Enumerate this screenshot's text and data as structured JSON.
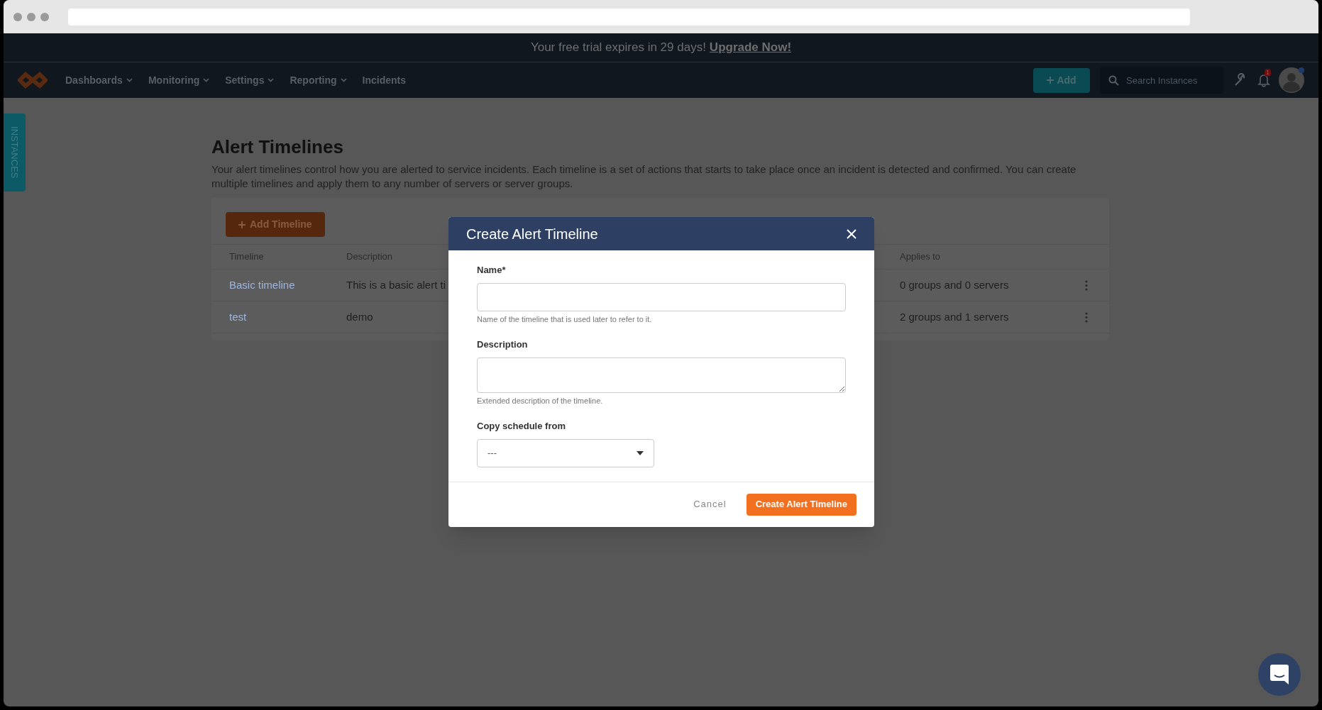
{
  "banner": {
    "text": "Your free trial expires in 29 days!",
    "link": "Upgrade Now!"
  },
  "nav": {
    "items": [
      {
        "label": "Dashboards",
        "dropdown": true
      },
      {
        "label": "Monitoring",
        "dropdown": true
      },
      {
        "label": "Settings",
        "dropdown": true
      },
      {
        "label": "Reporting",
        "dropdown": true
      },
      {
        "label": "Incidents",
        "dropdown": false
      }
    ],
    "add_button": "Add",
    "search": {
      "placeholder": "Search Instances"
    },
    "notification_count": "1"
  },
  "side_tab": "INSTANCES",
  "page": {
    "title": "Alert Timelines",
    "description": "Your alert timelines control how you are alerted to service incidents. Each timeline is a set of actions that starts to take place once an incident is detected and confirmed. You can create multiple timelines and apply them to any number of servers or server groups.",
    "add_button": "Add Timeline",
    "table": {
      "columns": [
        "Timeline",
        "Description",
        "Applies to"
      ],
      "rows": [
        {
          "timeline": "Basic timeline",
          "description": "This is a basic alert ti",
          "applies_to": "0 groups and 0 servers"
        },
        {
          "timeline": "test",
          "description": "demo",
          "applies_to": "2 groups and 1 servers"
        }
      ]
    }
  },
  "dialog": {
    "title": "Create Alert Timeline",
    "fields": [
      {
        "kind": "input",
        "label": "Name*",
        "hint": "Name of the timeline that is used later to refer to it."
      },
      {
        "kind": "textarea",
        "label": "Description",
        "hint": "Extended description of the timeline."
      },
      {
        "kind": "select",
        "label": "Copy schedule from",
        "value": "---"
      }
    ],
    "buttons": [
      {
        "label": "Cancel",
        "primary": false
      },
      {
        "label": "Create Alert Timeline",
        "primary": true
      }
    ]
  }
}
